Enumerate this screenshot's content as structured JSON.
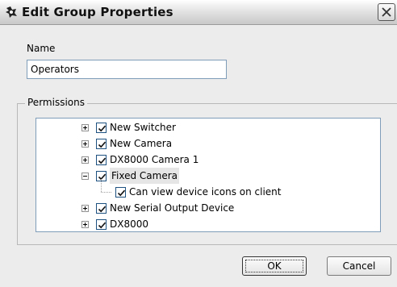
{
  "window": {
    "title": "Edit Group Properties",
    "icon": "app-glyph-icon",
    "close_icon": "close-icon"
  },
  "form": {
    "name_label": "Name",
    "name_value": "Operators",
    "permissions_label": "Permissions"
  },
  "tree": {
    "items": [
      {
        "label": "New Switcher",
        "checked": true,
        "expander": "plus",
        "level": 0
      },
      {
        "label": "New Camera",
        "checked": true,
        "expander": "plus",
        "level": 0
      },
      {
        "label": "DX8000 Camera 1",
        "checked": true,
        "expander": "plus",
        "level": 0
      },
      {
        "label": "Fixed Camera",
        "checked": true,
        "expander": "minus",
        "level": 0,
        "selected": true
      },
      {
        "label": "Can view device icons on client",
        "checked": true,
        "expander": null,
        "level": 1
      },
      {
        "label": "New Serial Output Device",
        "checked": true,
        "expander": "plus",
        "level": 0
      },
      {
        "label": "DX8000",
        "checked": true,
        "expander": "plus",
        "level": 0
      }
    ],
    "scroll_position": 0.85
  },
  "buttons": {
    "ok_label": "OK",
    "cancel_label": "Cancel"
  }
}
